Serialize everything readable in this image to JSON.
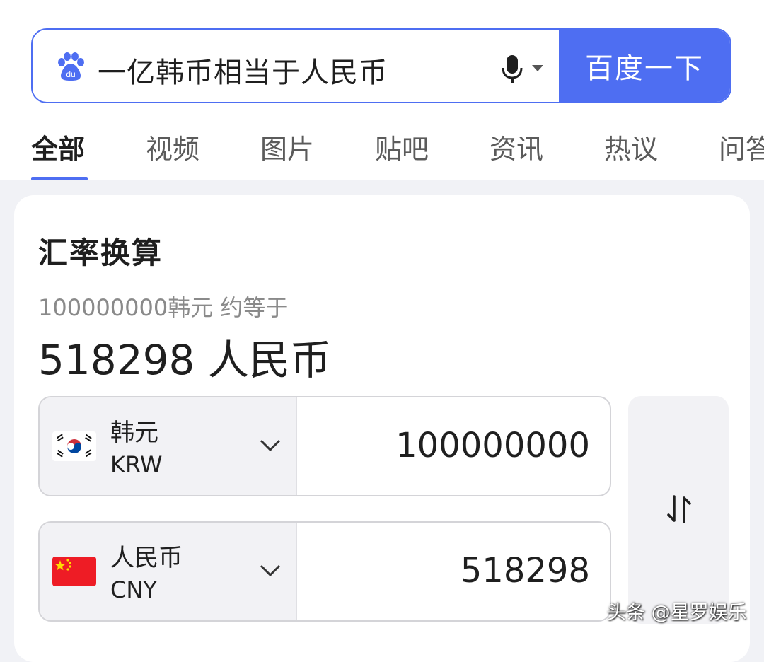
{
  "search": {
    "query": "一亿韩币相当于人民币",
    "button_label": "百度一下",
    "logo_icon": "baidu-paw-icon",
    "mic_icon": "microphone-icon"
  },
  "tabs": [
    {
      "label": "全部",
      "active": true
    },
    {
      "label": "视频",
      "active": false
    },
    {
      "label": "图片",
      "active": false
    },
    {
      "label": "贴吧",
      "active": false
    },
    {
      "label": "资讯",
      "active": false
    },
    {
      "label": "热议",
      "active": false
    },
    {
      "label": "问答",
      "active": false
    }
  ],
  "converter": {
    "title": "汇率换算",
    "summary_line": "100000000韩元 约等于",
    "result_line": "518298 人民币",
    "from": {
      "name": "韩元",
      "code": "KRW",
      "amount": "100000000",
      "flag_icon": "south-korea-flag-icon"
    },
    "to": {
      "name": "人民币",
      "code": "CNY",
      "amount": "518298",
      "flag_icon": "china-flag-icon"
    },
    "swap_icon": "swap-arrows-icon"
  },
  "watermark": "头条 @星罗娱乐",
  "colors": {
    "accent": "#4e6ef2",
    "page_bg": "#f1f2f6",
    "cny_flag_red": "#ee1c25",
    "cny_flag_star": "#ffde00",
    "krw_flag_red": "#cd2e3a",
    "krw_flag_blue": "#0047a0"
  }
}
